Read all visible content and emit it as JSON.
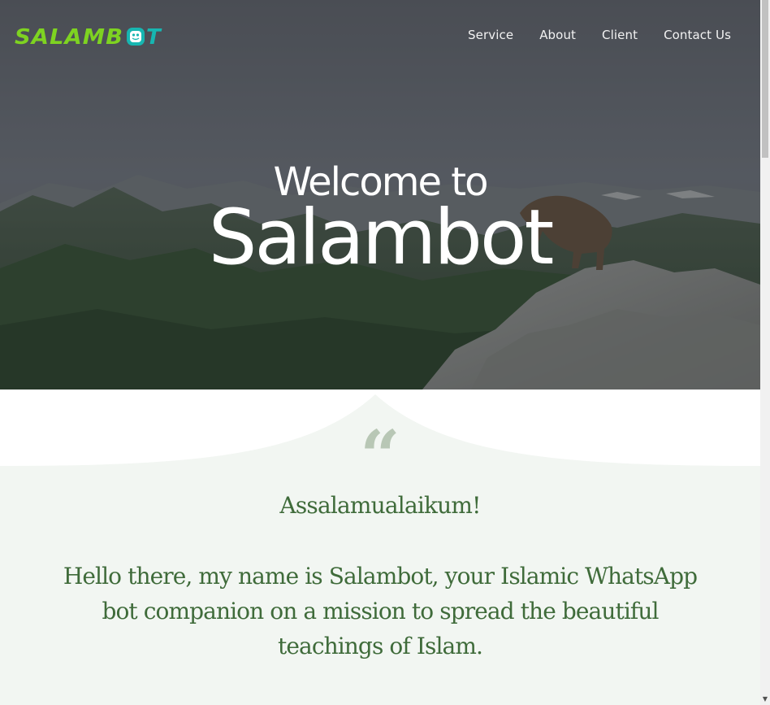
{
  "brand": {
    "logo_text": "SALAMBOT",
    "logo_colors": {
      "green": "#7ed321",
      "teal": "#17b6b1"
    }
  },
  "nav": {
    "items": [
      {
        "label": "Service"
      },
      {
        "label": "About"
      },
      {
        "label": "Client"
      },
      {
        "label": "Contact Us"
      }
    ]
  },
  "hero": {
    "subtitle": "Welcome to",
    "title": "Salambot"
  },
  "intro": {
    "quote_icon": "quote-icon",
    "greeting": "Assalamualaikum!",
    "message": "Hello there, my name is Salambot, your Islamic WhatsApp bot companion on a mission to spread the beautiful teachings of Islam."
  },
  "colors": {
    "accent_green": "#3f6b3a",
    "section_bg": "#f2f6f2",
    "quote_color": "#b8c7b5"
  }
}
